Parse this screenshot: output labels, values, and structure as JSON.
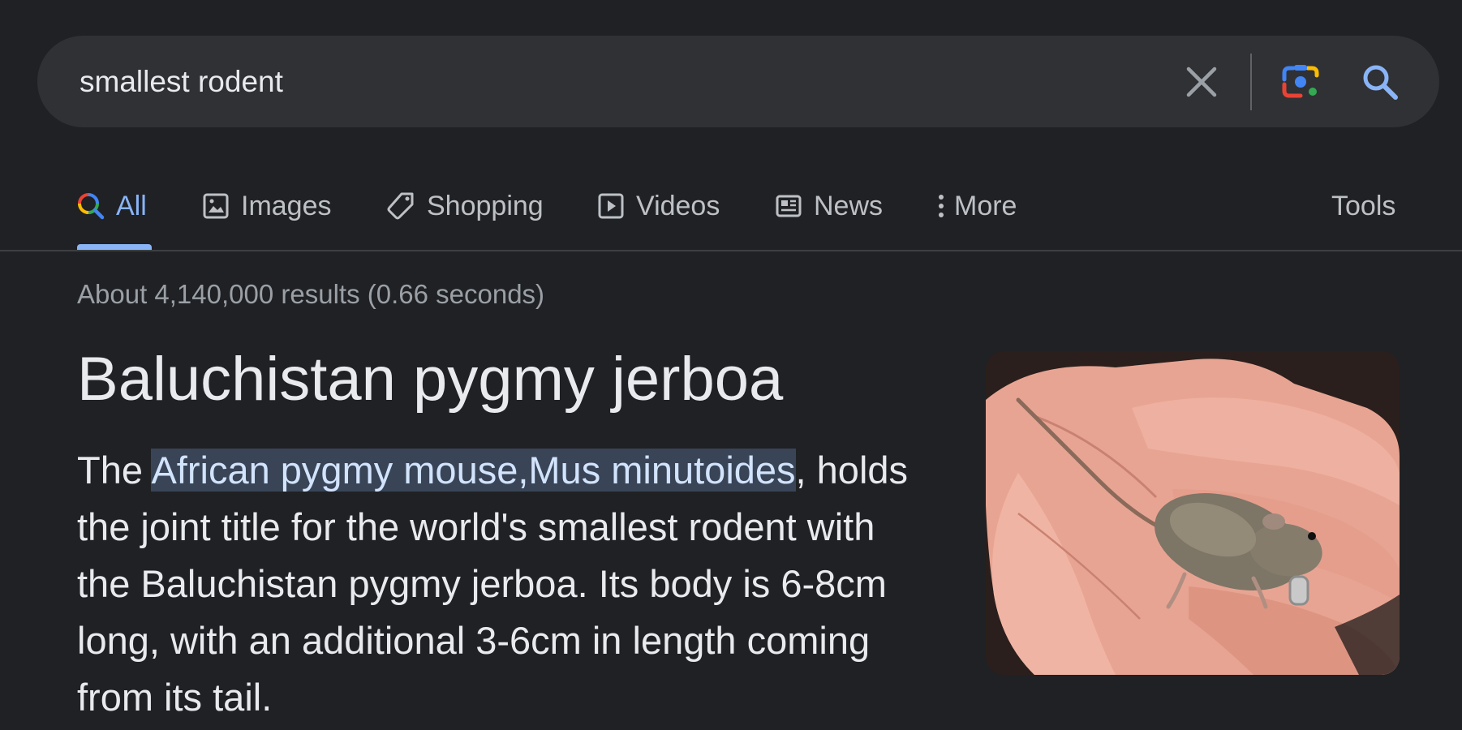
{
  "search": {
    "query": "smallest rodent"
  },
  "tabs": [
    {
      "label": "All",
      "icon": "multicolor-search-icon",
      "active": true
    },
    {
      "label": "Images",
      "icon": "image-icon"
    },
    {
      "label": "Shopping",
      "icon": "tag-icon"
    },
    {
      "label": "Videos",
      "icon": "play-icon"
    },
    {
      "label": "News",
      "icon": "news-icon"
    },
    {
      "label": "More",
      "icon": "more-vert-icon"
    }
  ],
  "tools_label": "Tools",
  "stats": "About 4,140,000 results (0.66 seconds)",
  "answer": {
    "title": "Baluchistan pygmy jerboa",
    "snippet_before": "The ",
    "snippet_highlight": "African pygmy mouse,Mus minutoides",
    "snippet_after": ", holds the joint title for the world's smallest rodent with the Baluchistan pygmy jerboa. Its body is 6-8cm long, with an additional 3-6cm in length coming from its tail."
  },
  "colors": {
    "background": "#202124",
    "search_bar": "#303134",
    "accent": "#8ab4f8",
    "highlight": "#394457"
  }
}
